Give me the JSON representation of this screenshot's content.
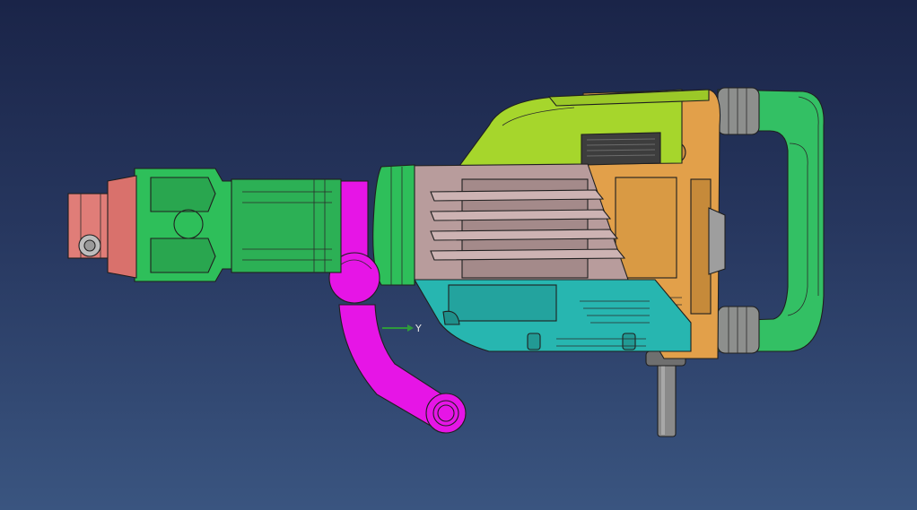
{
  "viewport": {
    "background_top": "#1a2448",
    "background_bottom": "#3a5580"
  },
  "axis": {
    "label": "Y",
    "color": "#2e9a3c"
  },
  "model": {
    "parts": [
      {
        "name": "chisel-holder",
        "color": "#e07d78"
      },
      {
        "name": "tool-head",
        "color": "#2ebf5a"
      },
      {
        "name": "side-handle",
        "color": "#e615e6"
      },
      {
        "name": "top-cover",
        "color": "#a6d62c"
      },
      {
        "name": "motor-housing",
        "color": "#b89c9c"
      },
      {
        "name": "lower-housing",
        "color": "#27b6b0"
      },
      {
        "name": "gear-case",
        "color": "#e2a04a"
      },
      {
        "name": "rear-handle",
        "color": "#33c064"
      },
      {
        "name": "power-cord",
        "color": "#8a8a8a"
      }
    ]
  }
}
